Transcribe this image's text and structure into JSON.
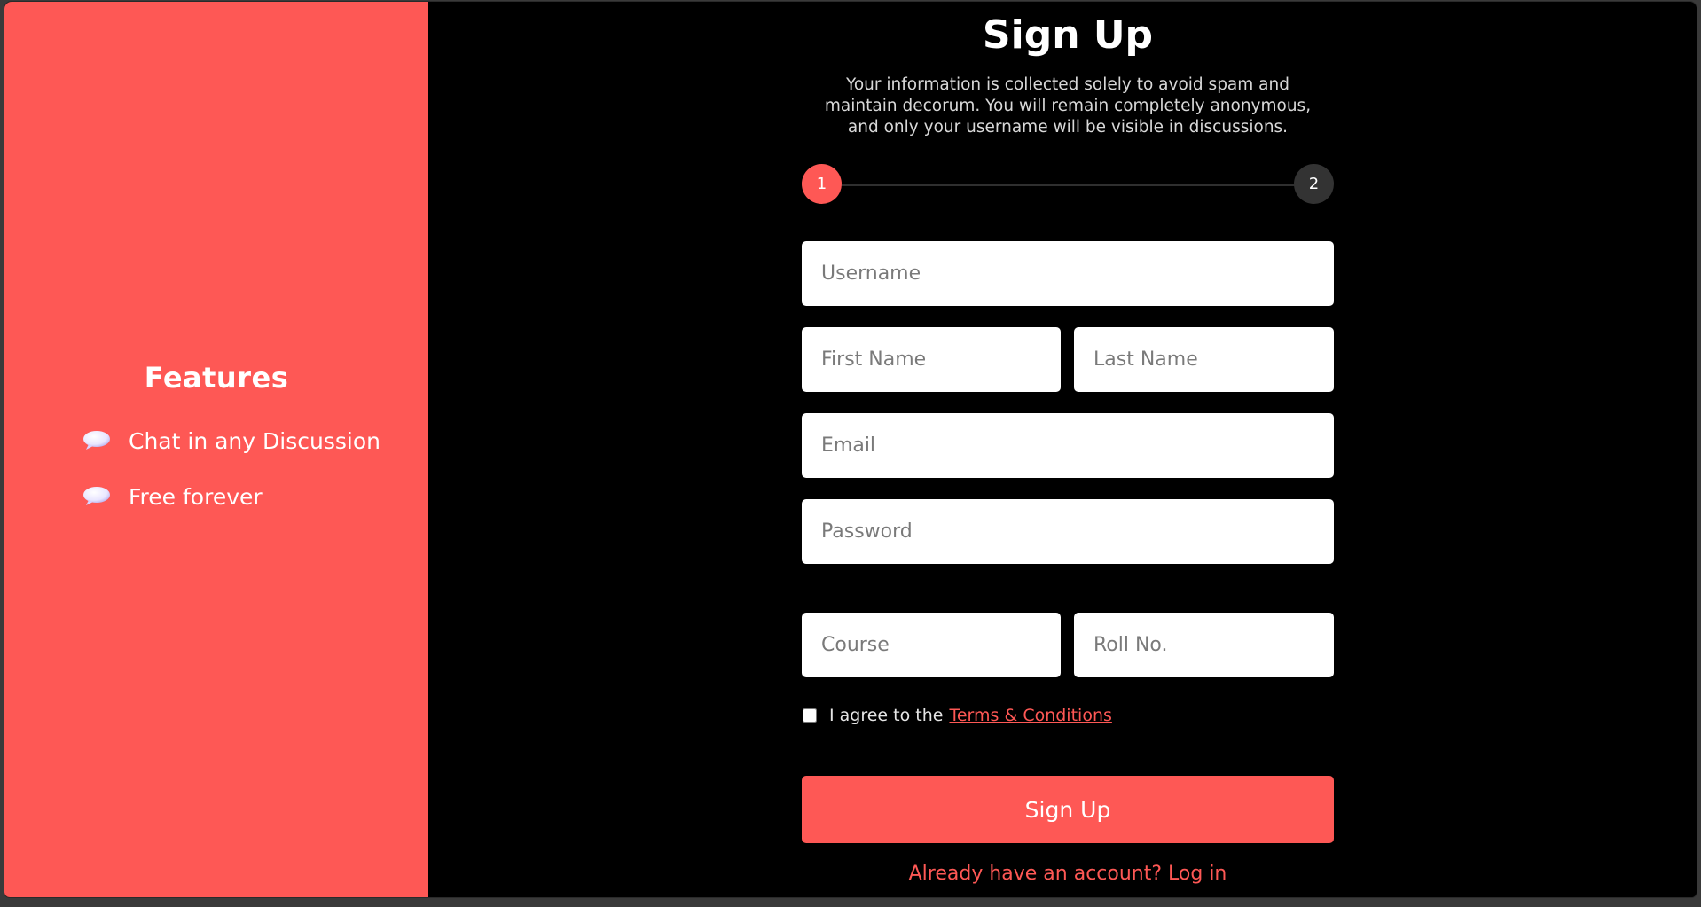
{
  "sidebar": {
    "title": "Features",
    "items": [
      {
        "label": "Chat in any Discussion",
        "icon": "speech-bubble-icon"
      },
      {
        "label": "Free forever",
        "icon": "speech-bubble-icon"
      }
    ]
  },
  "form": {
    "title": "Sign Up",
    "description": "Your information is collected solely to avoid spam and maintain decorum. You will remain completely anonymous, and only your username will be visible in discussions.",
    "steps": [
      "1",
      "2"
    ],
    "active_step": "1",
    "fields": {
      "username": {
        "placeholder": "Username",
        "value": ""
      },
      "first_name": {
        "placeholder": "First Name",
        "value": ""
      },
      "last_name": {
        "placeholder": "Last Name",
        "value": ""
      },
      "email": {
        "placeholder": "Email",
        "value": ""
      },
      "password": {
        "placeholder": "Password",
        "value": ""
      },
      "course": {
        "placeholder": "Course",
        "value": ""
      },
      "roll_no": {
        "placeholder": "Roll No.",
        "value": ""
      }
    },
    "terms_prefix": "I agree to the",
    "terms_link": "Terms & Conditions",
    "terms_checked": false,
    "submit_label": "Sign Up",
    "login_text": "Already have an account? Log in"
  },
  "colors": {
    "accent": "#fe5855",
    "background": "#000000",
    "step_inactive": "#333333"
  }
}
